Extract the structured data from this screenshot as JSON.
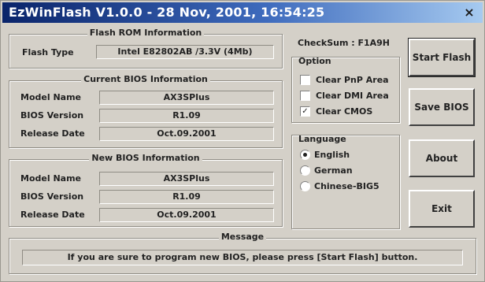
{
  "window": {
    "title": "EzWinFlash V1.0.0 - 28 Nov, 2001, 16:54:25",
    "close_glyph": "×"
  },
  "flash_rom": {
    "title": "Flash ROM Information",
    "type_label": "Flash Type",
    "type_value": "Intel E82802AB  /3.3V (4Mb)"
  },
  "current_bios": {
    "title": "Current BIOS Information",
    "model_label": "Model Name",
    "model_value": "AX3SPlus",
    "version_label": "BIOS Version",
    "version_value": "R1.09",
    "date_label": "Release Date",
    "date_value": "Oct.09.2001"
  },
  "new_bios": {
    "title": "New BIOS Information",
    "model_label": "Model Name",
    "model_value": "AX3SPlus",
    "version_label": "BIOS Version",
    "version_value": "R1.09",
    "date_label": "Release Date",
    "date_value": "Oct.09.2001"
  },
  "checksum": {
    "text": "CheckSum : F1A9H"
  },
  "options": {
    "title": "Option",
    "items": [
      {
        "label": "Clear PnP Area",
        "checked": false
      },
      {
        "label": "Clear DMI Area",
        "checked": false
      },
      {
        "label": "Clear CMOS",
        "checked": true
      }
    ]
  },
  "language": {
    "title": "Language",
    "items": [
      {
        "label": "English",
        "selected": true
      },
      {
        "label": "German",
        "selected": false
      },
      {
        "label": "Chinese-BIG5",
        "selected": false
      }
    ]
  },
  "buttons": {
    "start_flash": "Start Flash",
    "save_bios": "Save BIOS",
    "about": "About",
    "exit": "Exit"
  },
  "message": {
    "title": "Message",
    "text": "If you are sure to program new BIOS, please press [Start Flash] button."
  },
  "glyphs": {
    "check": "✓"
  },
  "colors": {
    "title_dark": "#0a246a",
    "title_light": "#a6caf0",
    "face": "#d4d0c8"
  }
}
